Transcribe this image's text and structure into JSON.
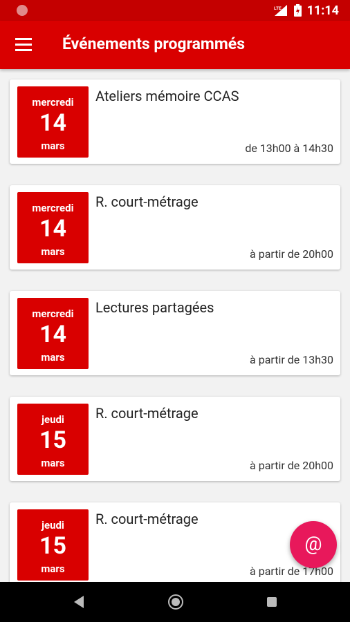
{
  "status_bar": {
    "time": "11:14",
    "network": "LTE",
    "icons": [
      "notification-dot-icon",
      "signal-icon",
      "battery-icon"
    ]
  },
  "app_bar": {
    "title": "Événements programmés",
    "menu_icon": "hamburger-menu-icon"
  },
  "events": [
    {
      "weekday": "mercredi",
      "day": "14",
      "month": "mars",
      "title": "Ateliers mémoire CCAS",
      "time": "de 13h00 à 14h30"
    },
    {
      "weekday": "mercredi",
      "day": "14",
      "month": "mars",
      "title": "R. court-métrage",
      "time": "à partir de 20h00"
    },
    {
      "weekday": "mercredi",
      "day": "14",
      "month": "mars",
      "title": "Lectures partagées",
      "time": "à partir de 13h30"
    },
    {
      "weekday": "jeudi",
      "day": "15",
      "month": "mars",
      "title": "R. court-métrage",
      "time": "à partir de 20h00"
    },
    {
      "weekday": "jeudi",
      "day": "15",
      "month": "mars",
      "title": "R. court-métrage",
      "time": "à partir de 17h00"
    }
  ],
  "fab": {
    "label": "@",
    "icon": "at-sign-icon"
  },
  "nav_bar": {
    "icons": [
      "back-icon",
      "home-icon",
      "recents-icon"
    ]
  },
  "colors": {
    "status_bar": "#c40000",
    "app_bar": "#d90000",
    "date_badge": "#d90000",
    "fab": "#e8185b",
    "background": "#f2f2f2"
  }
}
